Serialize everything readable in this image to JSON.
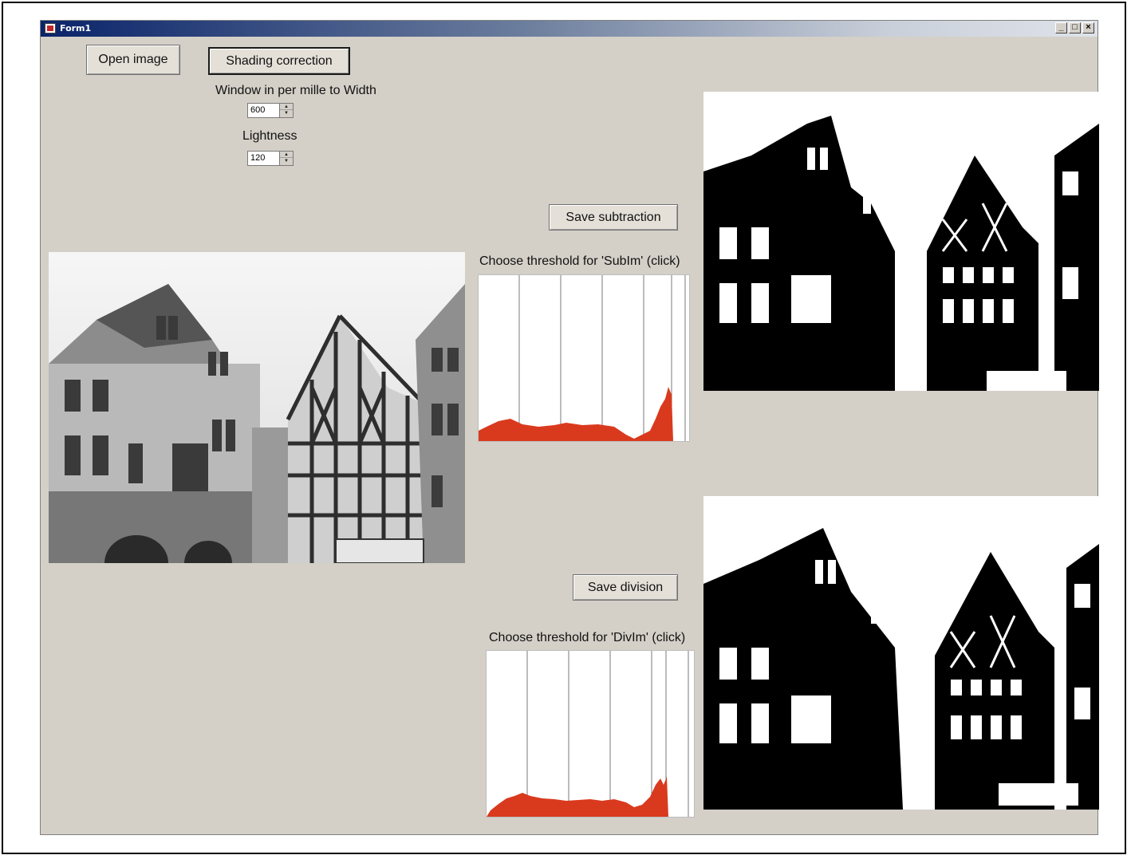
{
  "window": {
    "title": "Form1",
    "minimize_glyph": "_",
    "maximize_glyph": "□",
    "close_glyph": "×"
  },
  "buttons": {
    "open_image": "Open image",
    "shading_correction": "Shading correction",
    "save_subtraction": "Save subtraction",
    "save_division": "Save division"
  },
  "controls": {
    "window_label": "Window in per mille to Width",
    "window_value": "600",
    "lightness_label": "Lightness",
    "lightness_value": "120"
  },
  "histograms": {
    "subim_label": "Choose threshold for 'SubIm' (click)",
    "divim_label": "Choose threshold for 'DivIm' (click)",
    "fill_color": "#d93a1e"
  },
  "images": {
    "original": "grayscale-photo-of-half-timbered-houses",
    "subtraction_result": "binary-thresholded-image-subim",
    "division_result": "binary-thresholded-image-divim"
  }
}
